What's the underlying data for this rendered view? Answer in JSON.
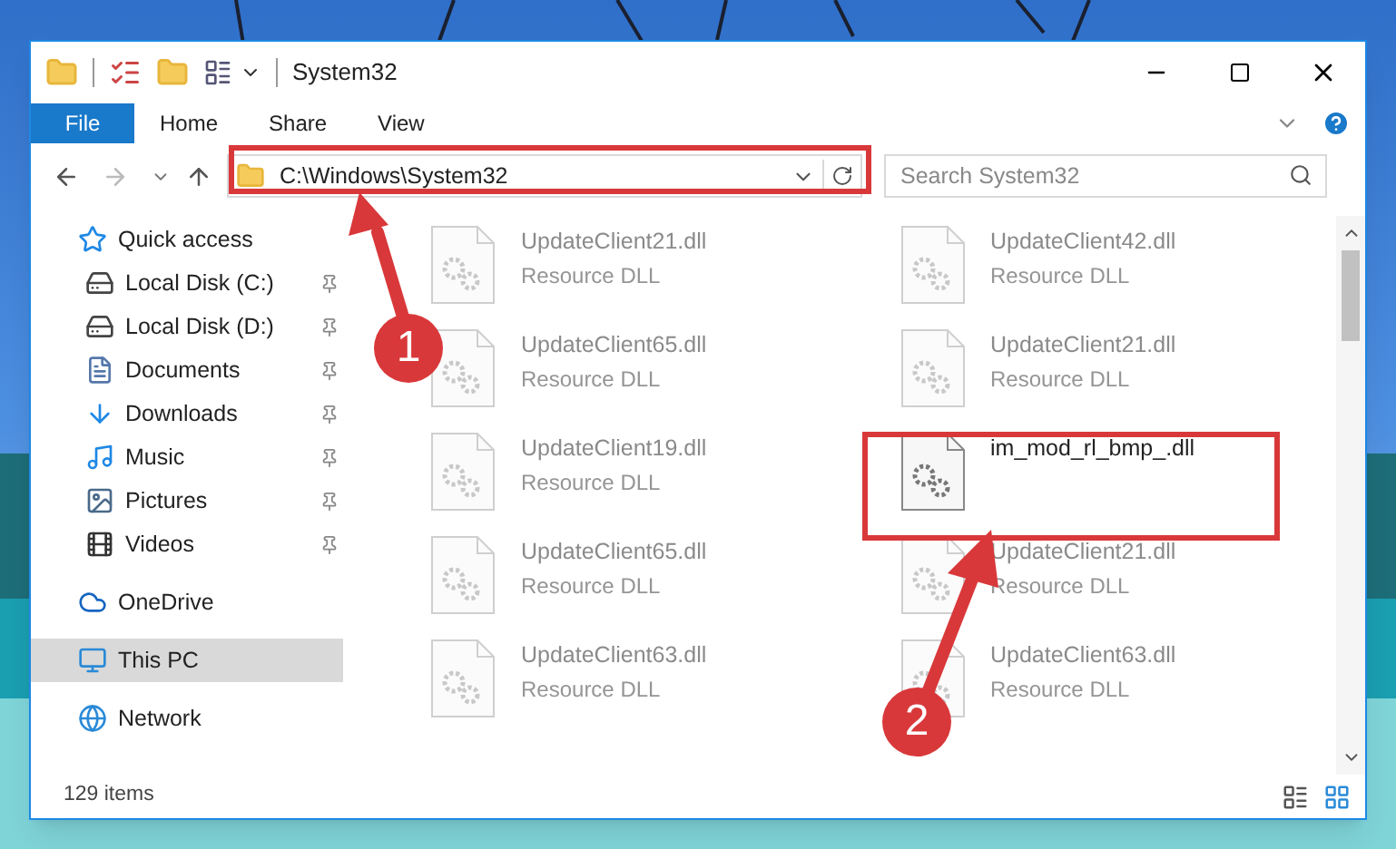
{
  "window": {
    "title": "System32"
  },
  "ribbon": {
    "tabs": [
      {
        "label": "File",
        "selected": true
      },
      {
        "label": "Home",
        "selected": false
      },
      {
        "label": "Share",
        "selected": false
      },
      {
        "label": "View",
        "selected": false
      }
    ]
  },
  "address": {
    "value": "C:\\Windows\\System32"
  },
  "search": {
    "placeholder": "Search System32"
  },
  "nav": [
    {
      "label": "Quick access",
      "kind": "quick",
      "pinned": false,
      "selected": false,
      "indent": false
    },
    {
      "label": "Local Disk (C:)",
      "kind": "diskc",
      "pinned": true,
      "selected": false,
      "indent": true
    },
    {
      "label": "Local Disk (D:)",
      "kind": "disk",
      "pinned": true,
      "selected": false,
      "indent": true
    },
    {
      "label": "Documents",
      "kind": "docs",
      "pinned": true,
      "selected": false,
      "indent": true
    },
    {
      "label": "Downloads",
      "kind": "downloads",
      "pinned": true,
      "selected": false,
      "indent": true
    },
    {
      "label": "Music",
      "kind": "music",
      "pinned": true,
      "selected": false,
      "indent": true
    },
    {
      "label": "Pictures",
      "kind": "pictures",
      "pinned": true,
      "selected": false,
      "indent": true
    },
    {
      "label": "Videos",
      "kind": "videos",
      "pinned": true,
      "selected": false,
      "indent": true
    },
    {
      "label": "OneDrive",
      "kind": "onedrive",
      "pinned": false,
      "selected": false,
      "indent": false
    },
    {
      "label": "This PC",
      "kind": "pc",
      "pinned": false,
      "selected": true,
      "indent": false
    },
    {
      "label": "Network",
      "kind": "network",
      "pinned": false,
      "selected": false,
      "indent": false
    }
  ],
  "files": [
    {
      "name": "UpdateClient21.dll",
      "type": "Resource DLL",
      "blurred": true
    },
    {
      "name": "UpdateClient42.dll",
      "type": "Resource DLL",
      "blurred": true
    },
    {
      "name": "UpdateClient65.dll",
      "type": "Resource DLL",
      "blurred": true
    },
    {
      "name": "UpdateClient21.dll",
      "type": "Resource DLL",
      "blurred": true
    },
    {
      "name": "UpdateClient19.dll",
      "type": "Resource DLL",
      "blurred": true
    },
    {
      "name": "im_mod_rl_bmp_.dll",
      "blurred": false
    },
    {
      "name": "UpdateClient65.dll",
      "type": "Resource DLL",
      "blurred": true
    },
    {
      "name": "UpdateClient21.dll",
      "type": "Resource DLL",
      "blurred": true
    },
    {
      "name": "UpdateClient63.dll",
      "type": "Resource DLL",
      "blurred": true
    },
    {
      "name": "UpdateClient63.dll",
      "type": "Resource DLL",
      "blurred": true
    }
  ],
  "status_bar": {
    "count": "129 items"
  },
  "annotations": [
    {
      "number": "1"
    },
    {
      "number": "2"
    }
  ]
}
